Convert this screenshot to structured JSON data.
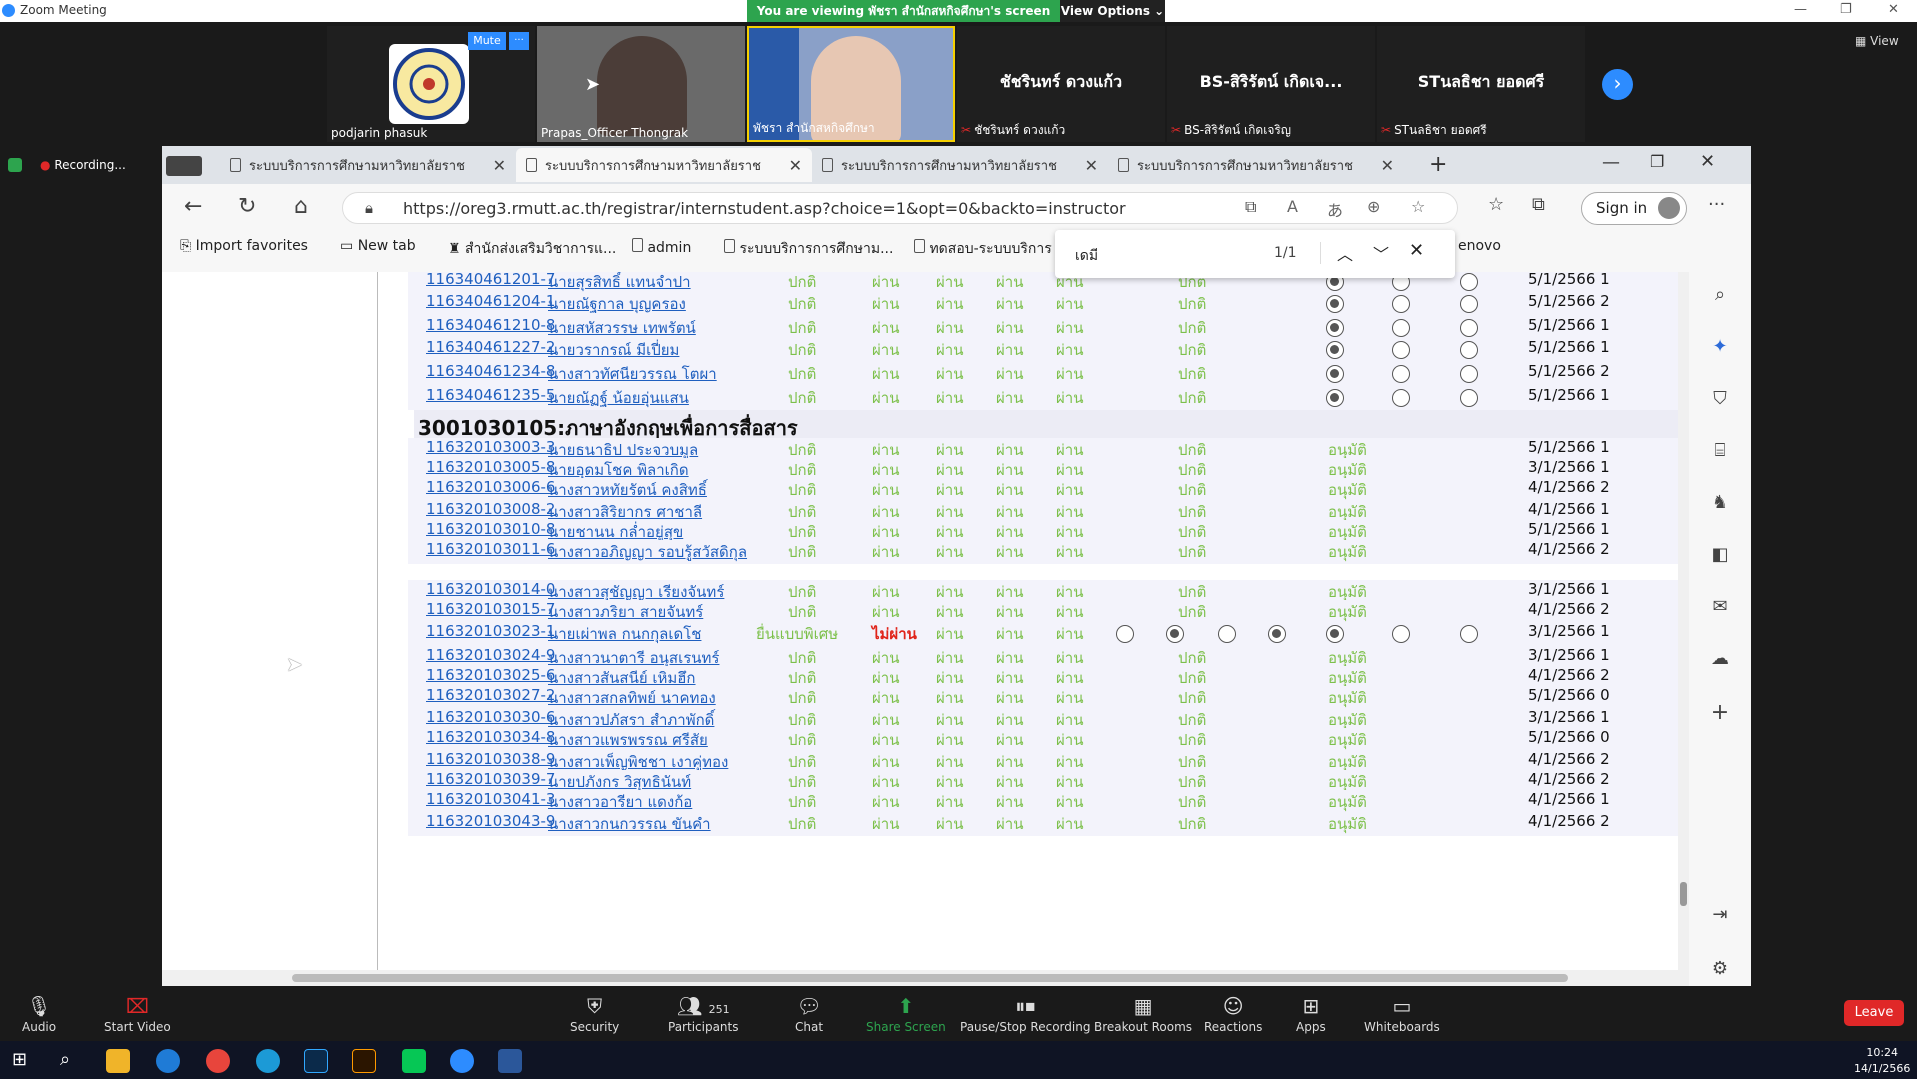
{
  "titlebar": {
    "title": "Zoom Meeting"
  },
  "banner": {
    "viewing": "You are viewing พัชรา สำนักสหกิจศึกษา's screen",
    "view_options": "View Options"
  },
  "video": {
    "tiles": [
      {
        "name": "podjarin phasuk",
        "mute": "Mute",
        "more": "···"
      },
      {
        "name": "Prapas_Officer Thongrak"
      },
      {
        "name": "พัชรา สำนักสหกิจศึกษา"
      },
      {
        "name": "ชัชรินทร์ ดวงแก้ว",
        "big": "ชัชรินทร์  ดวงแก้ว"
      },
      {
        "name": "BS-สิริรัตน์ เกิดเจริญ",
        "big": "BS-สิริรัตน์ เกิดเจ..."
      },
      {
        "name": "STนลธิชา ยอดศรี",
        "big": "STนลธิชา ยอดศรี"
      }
    ],
    "view_label": "View"
  },
  "recording": {
    "label": "Recording..."
  },
  "browser": {
    "tabs": [
      {
        "label": "ระบบบริการการศึกษามหาวิทยาลัยราช"
      },
      {
        "label": "ระบบบริการการศึกษามหาวิทยาลัยราช"
      },
      {
        "label": "ระบบบริการการศึกษามหาวิทยาลัยราช"
      },
      {
        "label": "ระบบบริการการศึกษามหาวิทยาลัยราช"
      }
    ],
    "url": "https://oreg3.rmutt.ac.th/registrar/internstudent.asp?choice=1&opt=0&backto=instructor",
    "signin": "Sign in",
    "favorites": [
      "Import favorites",
      "New tab",
      "สำนักส่งเสริมวิชาการแ...",
      "admin",
      "ระบบบริการการศึกษาม...",
      "ทดสอบ-ระบบบริการ",
      "enovo"
    ],
    "find": {
      "query": "เดมี",
      "count": "1/1"
    }
  },
  "table": {
    "rows_a": [
      {
        "id": "116340461201-7",
        "name": "นายสุรสิทธิ์ แทนจำปา",
        "d": "5/1/2566 1"
      },
      {
        "id": "116340461204-1",
        "name": "นายณัฐกาล บุญครอง",
        "d": "5/1/2566 2"
      },
      {
        "id": "116340461210-8",
        "name": "นายสหัสวรรษ เทพรัตน์",
        "d": "5/1/2566 1"
      },
      {
        "id": "116340461227-2",
        "name": "นายวรากรณ์ มีเปี่ยม",
        "d": "5/1/2566 1"
      },
      {
        "id": "116340461234-8",
        "name": "นางสาวทัศนียวรรณ โตผา",
        "d": "5/1/2566 2"
      },
      {
        "id": "116340461235-5",
        "name": "นายณัฏฐ์ น้อยอุ่นแสน",
        "d": "5/1/2566 1"
      }
    ],
    "section": "3001030105:ภาษาอังกฤษเพื่อการสื่อสาร",
    "rows_b": [
      {
        "id": "116320103003-3",
        "name": "นายธนาธิป ประจวบมูล",
        "d": "5/1/2566 1"
      },
      {
        "id": "116320103005-8",
        "name": "นายอุดมโชค พิลาเกิด",
        "d": "3/1/2566 1"
      },
      {
        "id": "116320103006-6",
        "name": "นางสาวหทัยรัตน์ คงสิทธิ์",
        "d": "4/1/2566 2"
      },
      {
        "id": "116320103008-2",
        "name": "นางสาวสิริยากร ศาชาลี",
        "d": "4/1/2566 1"
      },
      {
        "id": "116320103010-8",
        "name": "นายชานน กล่ำอยู่สุข",
        "d": "5/1/2566 1"
      },
      {
        "id": "116320103011-6",
        "name": "นางสาวอภิญญา รอบรู้สวัสดิกุล",
        "d": "4/1/2566 2"
      },
      {
        "id": "116320103014-0",
        "name": "นางสาวสุชัญญา เรียงจันทร์",
        "d": "3/1/2566 1"
      },
      {
        "id": "116320103015-7",
        "name": "นางสาวภริยา สายจันทร์",
        "d": "4/1/2566 2"
      },
      {
        "id": "116320103023-1",
        "name": "นายเผ่าพล กนกกุลเดโช",
        "d": "3/1/2566 1",
        "special": "ยื่นแบบพิเศษ",
        "fail": "ไม่ผ่าน"
      },
      {
        "id": "116320103024-9",
        "name": "นางสาวนาตารี อนุสเรนทร์",
        "d": "3/1/2566 1"
      },
      {
        "id": "116320103025-6",
        "name": "นางสาวสันสนีย์ เหิมฮึก",
        "d": "4/1/2566 2"
      },
      {
        "id": "116320103027-2",
        "name": "นางสาวสกลทิพย์ นาคทอง",
        "d": "5/1/2566 0"
      },
      {
        "id": "116320103030-6",
        "name": "นางสาวปภัสรา สำภาพักดิ์",
        "d": "3/1/2566 1"
      },
      {
        "id": "116320103034-8",
        "name": "นางสาวแพรพรรณ ศรีสัย",
        "d": "5/1/2566 0"
      },
      {
        "id": "116320103038-9",
        "name": "นางสาวเพ็ญพิชชา เงาคู่ทอง",
        "d": "4/1/2566 2"
      },
      {
        "id": "116320103039-7",
        "name": "นายปภังกร วิสุทธินันท์",
        "d": "4/1/2566 2"
      },
      {
        "id": "116320103041-3",
        "name": "นางสาวอารียา แดงก้อ",
        "d": "4/1/2566 1"
      },
      {
        "id": "116320103043-9",
        "name": "นางสาวกนกวรรณ ขันคำ",
        "d": "4/1/2566 2"
      }
    ],
    "normal": "ปกติ",
    "pass": "ผ่าน",
    "approved": "อนุมัติ"
  },
  "zoom": {
    "audio": "Audio",
    "video": "Start Video",
    "security": "Security",
    "participants": "Participants",
    "participants_count": "251",
    "chat": "Chat",
    "share": "Share Screen",
    "record": "Pause/Stop Recording",
    "breakout": "Breakout Rooms",
    "reactions": "Reactions",
    "apps": "Apps",
    "whiteboards": "Whiteboards",
    "leave": "Leave"
  },
  "taskbar": {
    "time": "10:24",
    "date": "14/1/2566"
  },
  "colors": {
    "accent": "#2d8cff",
    "pass": "#7cc04a",
    "link": "#1f5fbf",
    "fail": "#e0241a"
  }
}
